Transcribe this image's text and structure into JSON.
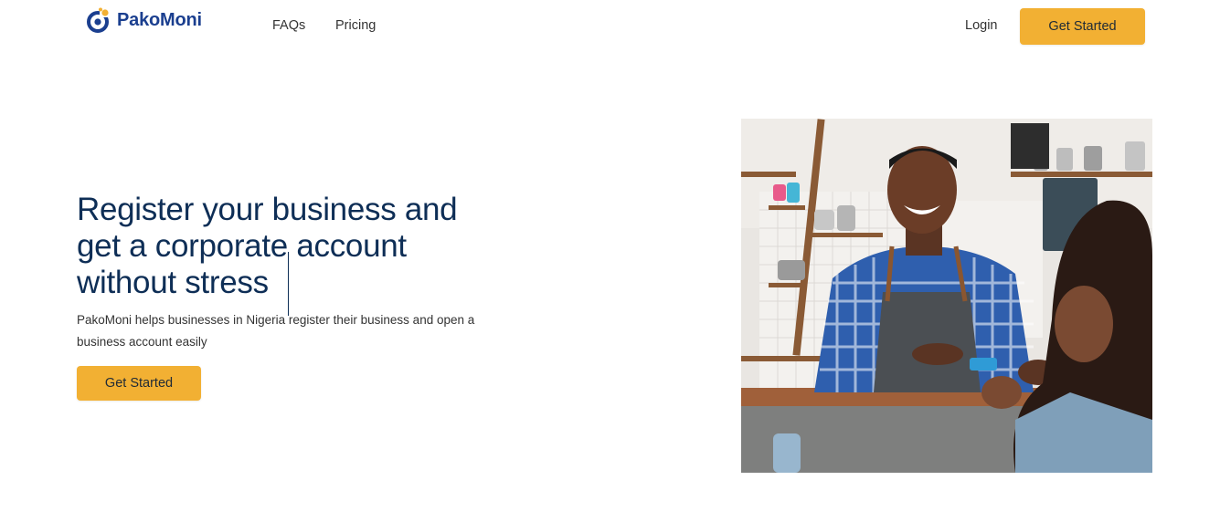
{
  "brand": {
    "name": "PakoMoni",
    "primary_color": "#1b3f8f",
    "accent_color": "#f2b033"
  },
  "nav": {
    "faqs": "FAQs",
    "pricing": "Pricing",
    "login": "Login",
    "cta": "Get Started"
  },
  "hero": {
    "title": "Register your business and get a corporate account without stress",
    "description": "PakoMoni helps businesses in Nigeria register their business and open a business account easily",
    "cta": "Get Started",
    "title_color": "#0e2e56"
  },
  "image": {
    "subject": "smiling man in blue checked shirt and apron at shop counter"
  }
}
